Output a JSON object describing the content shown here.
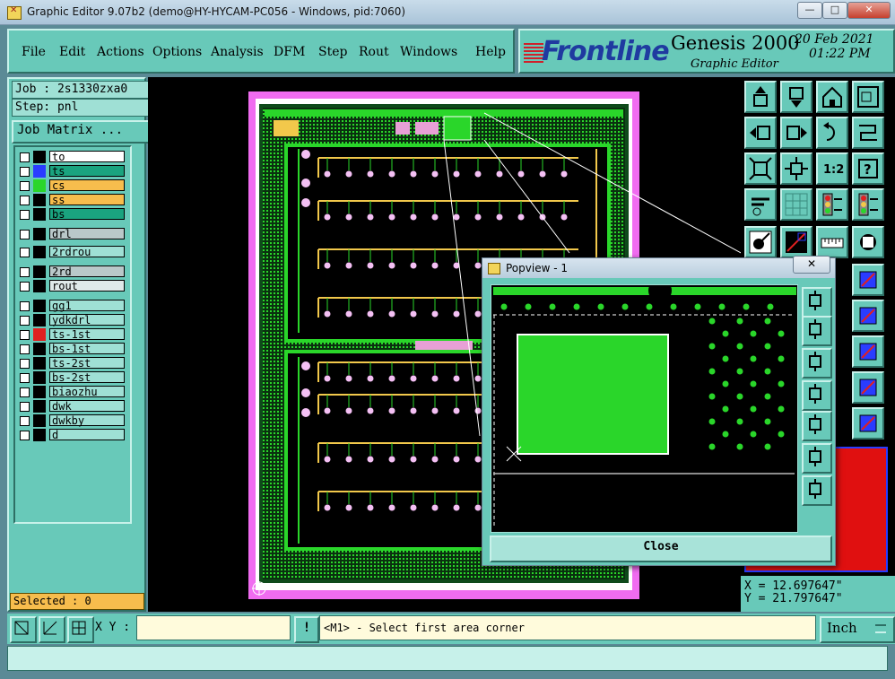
{
  "window": {
    "title": "Graphic Editor 9.07b2 (demo@HY-HYCAM-PC056 - Windows, pid:7060)",
    "controls": [
      "—",
      "□",
      "✕"
    ]
  },
  "menu": [
    {
      "label": "File"
    },
    {
      "label": "Edit"
    },
    {
      "label": "Actions"
    },
    {
      "label": "Options"
    },
    {
      "label": "Analysis"
    },
    {
      "label": "DFM"
    },
    {
      "label": "Step"
    },
    {
      "label": "Rout"
    },
    {
      "label": "Windows"
    },
    {
      "label": "Help"
    }
  ],
  "brand": {
    "logo": "Frontline",
    "product": "Genesis 2000",
    "subtitle": "Graphic Editor",
    "date": "20 Feb 2021",
    "time": "01:22 PM"
  },
  "job": {
    "job_label": "Job : 2s1330zxa0",
    "step_label": "Step: pnl",
    "matrix_button": "Job Matrix ..."
  },
  "layers": [
    {
      "name": "to",
      "swatch": "#000000",
      "bg": "#ffffff"
    },
    {
      "name": "ts",
      "swatch": "#2a3cff",
      "bg": "#1aa37f"
    },
    {
      "name": "cs",
      "swatch": "#2ad62a",
      "bg": "#f7bd4d"
    },
    {
      "name": "ss",
      "swatch": "#000000",
      "bg": "#f7bd4d"
    },
    {
      "name": "bs",
      "swatch": "#000000",
      "bg": "#1aa37f"
    },
    {
      "name": "drl",
      "swatch": "#000000",
      "bg": "#b9c8c9"
    },
    {
      "name": "2rdrou",
      "swatch": "#000000",
      "bg": "#9fe0d5"
    },
    {
      "name": "2rd",
      "swatch": "#000000",
      "bg": "#b9c8c9"
    },
    {
      "name": "rout",
      "swatch": "#000000",
      "bg": "#dfe9e9"
    },
    {
      "name": "gg1",
      "swatch": "#000000",
      "bg": "#9fe0d5"
    },
    {
      "name": "ydkdrl",
      "swatch": "#000000",
      "bg": "#9fe0d5"
    },
    {
      "name": "ts-1st",
      "swatch": "#e02020",
      "bg": "#9fe0d5"
    },
    {
      "name": "bs-1st",
      "swatch": "#000000",
      "bg": "#9fe0d5"
    },
    {
      "name": "ts-2st",
      "swatch": "#000000",
      "bg": "#9fe0d5"
    },
    {
      "name": "bs-2st",
      "swatch": "#000000",
      "bg": "#9fe0d5"
    },
    {
      "name": "biaozhu",
      "swatch": "#000000",
      "bg": "#9fe0d5"
    },
    {
      "name": "dwk",
      "swatch": "#000000",
      "bg": "#9fe0d5"
    },
    {
      "name": "dwkby",
      "swatch": "#000000",
      "bg": "#9fe0d5"
    },
    {
      "name": "d",
      "swatch": "#000000",
      "bg": "#9fe0d5"
    }
  ],
  "status": {
    "selected": "Selected : 0",
    "x": "X = 12.697647\"",
    "y": "Y = 21.797647\"",
    "xy_label": "X Y :",
    "xy_value": "",
    "prompt": "<M1> - Select first area corner",
    "units": "Inch",
    "command": ""
  },
  "toolbar_icons": [
    "move-up-icon",
    "move-down-icon",
    "home-icon",
    "zoom-window-icon",
    "move-left-icon",
    "move-right-icon",
    "undo-icon",
    "route-icon",
    "fit-icon",
    "center-icon",
    "one-to-two-icon",
    "help-icon",
    "tools-icon",
    "grid-icon",
    "traffic-light-icon",
    "traffic-light-2-icon",
    "snap-icon",
    "measure-icon",
    "ruler-icon",
    "pad-icon"
  ],
  "popview": {
    "title": "Popview - 1",
    "close_x": "✕",
    "close_button": "Close"
  },
  "colors": {
    "panel": "#68c9b9",
    "board_green": "#2ad62a",
    "route_yellow": "#f2c84b",
    "outline_pink": "#f06cf0"
  }
}
